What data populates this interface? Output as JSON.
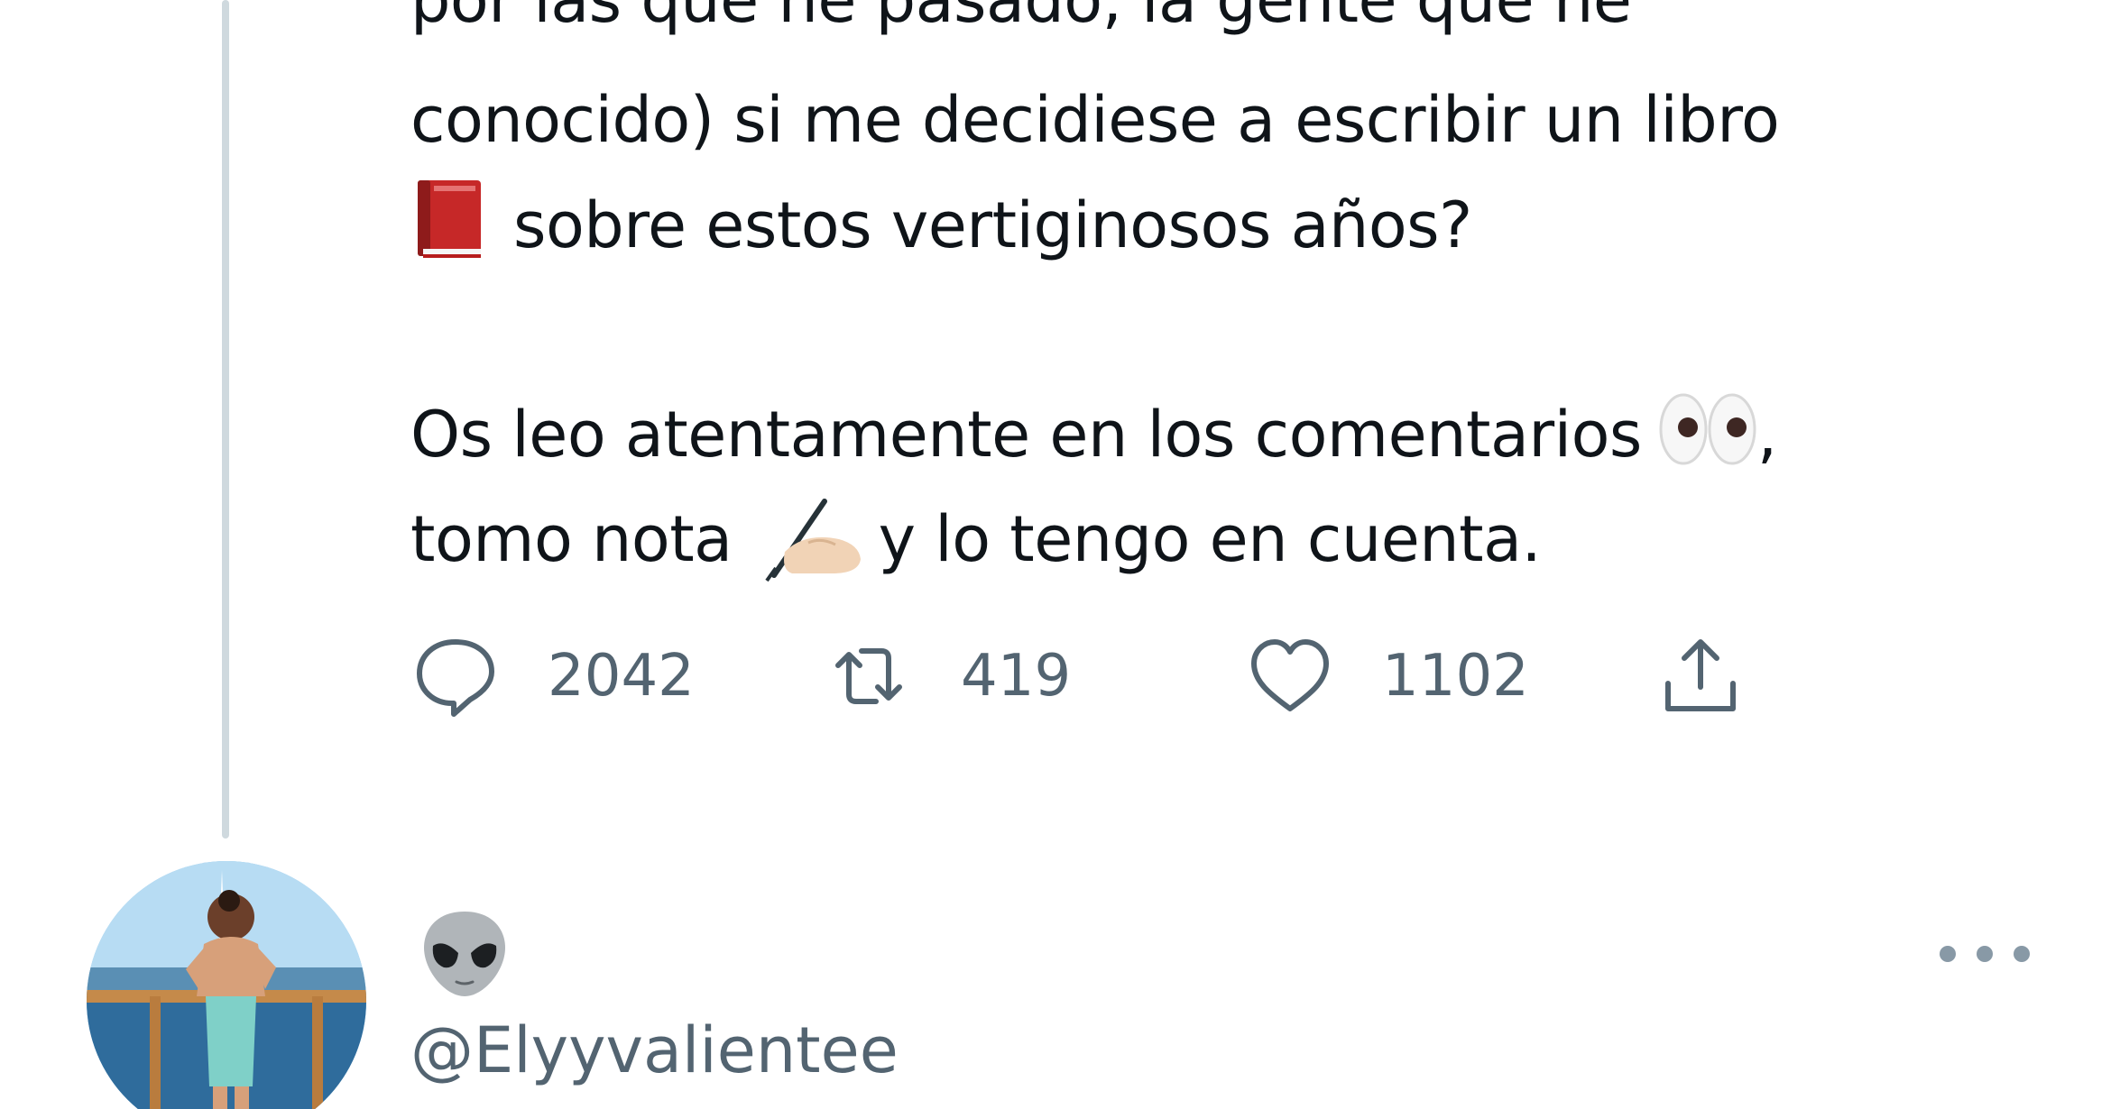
{
  "tweet": {
    "text_line1": "por las que he pasado, la gente que he",
    "text_line2": "conocido) si me decidiese a escribir un libro",
    "text_line3": "sobre estos vertiginosos años?",
    "text_line4": "Os leo atentamente en los comentarios",
    "text_line4_end": ",",
    "text_line5_start": "tomo nota",
    "text_line5_end": "y lo tengo en cuenta.",
    "emojis": [
      "red-book-icon",
      "eyes-icon",
      "writing-hand-icon"
    ]
  },
  "actions": {
    "reply_count": "2042",
    "retweet_count": "419",
    "like_count": "1102",
    "share_icon": "share-icon"
  },
  "reply": {
    "display_name_emoji": "alien-icon",
    "handle": "@Elyyvalientee",
    "more_icon": "more-icon"
  },
  "colors": {
    "text": "#0f1419",
    "muted": "#536471",
    "thread_line": "#cfd9de"
  }
}
